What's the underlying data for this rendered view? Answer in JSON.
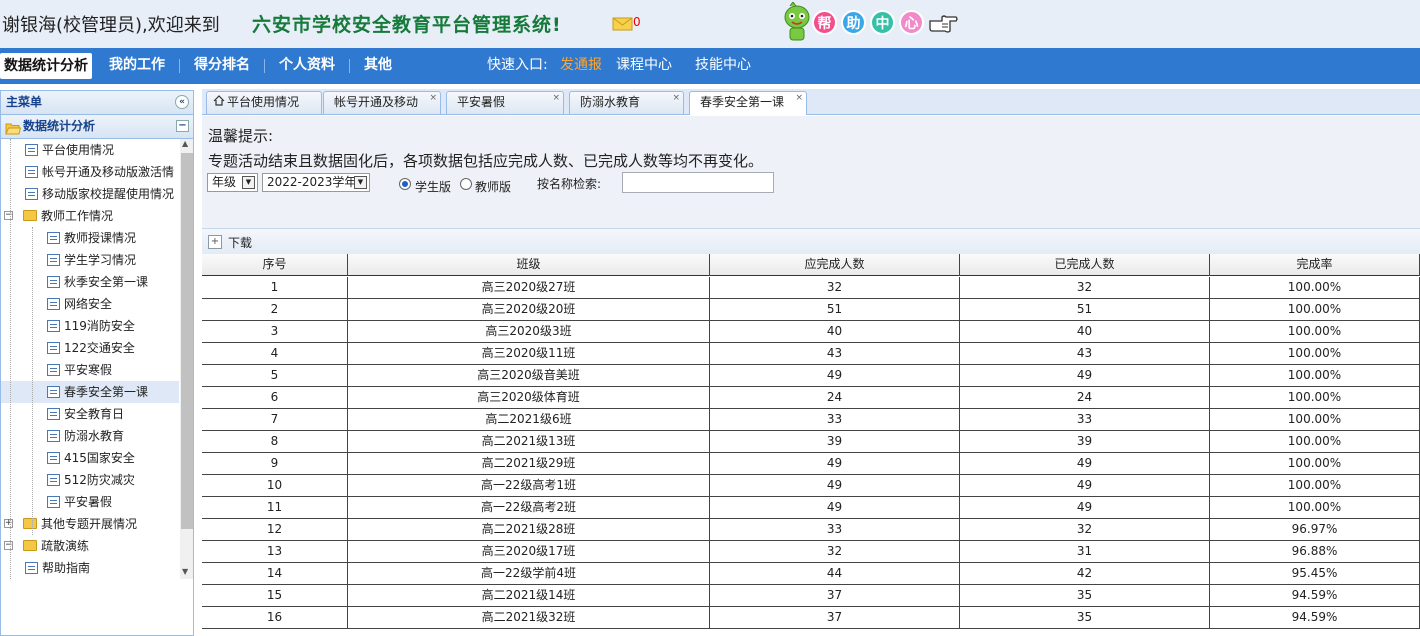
{
  "header": {
    "welcome": "谢银海(校管理员),欢迎来到",
    "system_title": "六安市学校安全教育平台管理系统!",
    "mail_count": "0",
    "help_chars": [
      "帮",
      "助",
      "中",
      "心"
    ],
    "help_colors": [
      "#f0508c",
      "#3aa8e8",
      "#35c0a8",
      "#f08ac8"
    ]
  },
  "menu": {
    "items": [
      "数据统计分析",
      "我的工作",
      "得分排名",
      "个人资料",
      "其他"
    ],
    "quick_label": "快速入口:",
    "quick_links": [
      "发通报",
      "课程中心",
      "技能中心"
    ],
    "quick_highlight_color": "#ffa42b"
  },
  "sidebar": {
    "title": "主菜单",
    "collapse_symbol": "«",
    "section_title": "数据统计分析",
    "section_toggle": "−",
    "nodes": [
      {
        "label": "平台使用情况",
        "type": "doc",
        "level": 1
      },
      {
        "label": "帐号开通及移动版激活情",
        "type": "doc",
        "level": 1
      },
      {
        "label": "移动版家校提醒使用情况",
        "type": "doc",
        "level": 1
      },
      {
        "label": "教师工作情况",
        "type": "folder",
        "level": 0,
        "toggle": "−"
      },
      {
        "label": "教师授课情况",
        "type": "doc",
        "level": 2
      },
      {
        "label": "学生学习情况",
        "type": "doc",
        "level": 2
      },
      {
        "label": "秋季安全第一课",
        "type": "doc",
        "level": 2
      },
      {
        "label": "网络安全",
        "type": "doc",
        "level": 2
      },
      {
        "label": "119消防安全",
        "type": "doc",
        "level": 2
      },
      {
        "label": "122交通安全",
        "type": "doc",
        "level": 2
      },
      {
        "label": "平安寒假",
        "type": "doc",
        "level": 2
      },
      {
        "label": "春季安全第一课",
        "type": "doc",
        "level": 2,
        "selected": true
      },
      {
        "label": "安全教育日",
        "type": "doc",
        "level": 2
      },
      {
        "label": "防溺水教育",
        "type": "doc",
        "level": 2
      },
      {
        "label": "415国家安全",
        "type": "doc",
        "level": 2
      },
      {
        "label": "512防灾减灾",
        "type": "doc",
        "level": 2
      },
      {
        "label": "平安暑假",
        "type": "doc",
        "level": 2
      },
      {
        "label": "其他专题开展情况",
        "type": "folder",
        "level": 0,
        "toggle": "+"
      },
      {
        "label": "疏散演练",
        "type": "folder",
        "level": 0,
        "toggle": "−"
      },
      {
        "label": "帮助指南",
        "type": "doc",
        "level": 1
      }
    ]
  },
  "tabs": [
    {
      "label": "平台使用情况",
      "home": true,
      "closable": false
    },
    {
      "label": "帐号开通及移动",
      "closable": true
    },
    {
      "label": "平安暑假",
      "closable": true
    },
    {
      "label": "防溺水教育",
      "closable": true
    },
    {
      "label": "春季安全第一课",
      "closable": true,
      "active": true
    }
  ],
  "content": {
    "tip_title": "温馨提示:",
    "tip_text": "专题活动结束且数据固化后，各项数据包括应完成人数、已完成人数等均不再变化。",
    "grade_select": "年级",
    "year_select": "2022-2023学年",
    "radio_student": "学生版",
    "radio_teacher": "教师版",
    "radio_selected": "学生版",
    "search_label": "按名称检索:",
    "search_value": "",
    "download_label": "下载"
  },
  "table": {
    "columns": [
      "序号",
      "班级",
      "应完成人数",
      "已完成人数",
      "完成率"
    ],
    "rows": [
      [
        "1",
        "高三2020级27班",
        "32",
        "32",
        "100.00%"
      ],
      [
        "2",
        "高三2020级20班",
        "51",
        "51",
        "100.00%"
      ],
      [
        "3",
        "高三2020级3班",
        "40",
        "40",
        "100.00%"
      ],
      [
        "4",
        "高三2020级11班",
        "43",
        "43",
        "100.00%"
      ],
      [
        "5",
        "高三2020级音美班",
        "49",
        "49",
        "100.00%"
      ],
      [
        "6",
        "高三2020级体育班",
        "24",
        "24",
        "100.00%"
      ],
      [
        "7",
        "高二2021级6班",
        "33",
        "33",
        "100.00%"
      ],
      [
        "8",
        "高二2021级13班",
        "39",
        "39",
        "100.00%"
      ],
      [
        "9",
        "高二2021级29班",
        "49",
        "49",
        "100.00%"
      ],
      [
        "10",
        "高一22级高考1班",
        "49",
        "49",
        "100.00%"
      ],
      [
        "11",
        "高一22级高考2班",
        "49",
        "49",
        "100.00%"
      ],
      [
        "12",
        "高二2021级28班",
        "33",
        "32",
        "96.97%"
      ],
      [
        "13",
        "高三2020级17班",
        "32",
        "31",
        "96.88%"
      ],
      [
        "14",
        "高一22级学前4班",
        "44",
        "42",
        "95.45%"
      ],
      [
        "15",
        "高二2021级14班",
        "37",
        "35",
        "94.59%"
      ],
      [
        "16",
        "高二2021级32班",
        "37",
        "35",
        "94.59%"
      ]
    ]
  }
}
